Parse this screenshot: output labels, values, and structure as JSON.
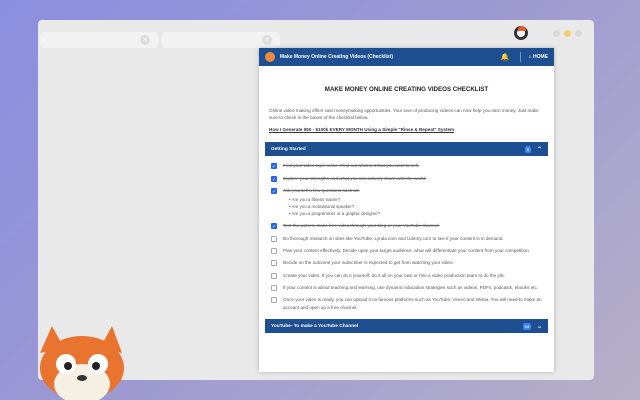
{
  "page": {
    "header": {
      "title": "Make Money Online Creating Videos (Checklist)",
      "home_label": "HOME",
      "bell_icon": "bell-icon",
      "home_icon": "home-icon"
    },
    "heading": "MAKE MONEY ONLINE CREATING VIDEOS CHECKLIST",
    "intro": "Online video making offers vast moneymaking opportunities. Your love of producing videos can now help you earn money. Just make sure to check in the boxes of the checklist below.",
    "link": "How I Generate $50 - $100k EVERY MONTH Using a Simple \"Rinse & Repeat\" System",
    "sections": [
      {
        "title": "Getting Started",
        "badge": "5"
      },
      {
        "title": "YouTube- To make a YouTube Channel",
        "badge": "14"
      }
    ],
    "items": [
      {
        "text": "Find your video topic niche. Find out what is it that you want to sell.",
        "checked": true
      },
      {
        "text": "Explore your strengths and what you can actively share with the world.",
        "checked": true
      },
      {
        "text": "Ask yourself a few questions such as:",
        "checked": true
      },
      {
        "text": "Test the waters, make free video through your blog or your YouTube channel.",
        "checked": true
      },
      {
        "text": "Do thorough research on sites like YouTube, Lynda.com and Udemy.com to see if your content is in demand.",
        "checked": false
      },
      {
        "text": "Plan your content effectively. Decide upon your target audience, what will differentiate your content from your competition.",
        "checked": false
      },
      {
        "text": "Decide on the outcome your subscriber is expected to get from watching your video.",
        "checked": false
      },
      {
        "text": "Create your video. If you can do it yourself, do it all on your own or hire a video production team to do the job.",
        "checked": false
      },
      {
        "text": "If your content is about teaching and learning, use dynamic education strategies such as videos, PDFs, podcasts, ebooks etc.",
        "checked": false
      },
      {
        "text": "Once your video is ready, you can upload it on famous platforms such as YouTube, Vimeo and Wistia. You will need to make an account and open up a free channel.",
        "checked": false
      }
    ],
    "subitems": [
      "Are you a fitness trainer?",
      "Are you a motivational speaker?",
      "Are you a programmer or a graphic designer?"
    ]
  },
  "colors": {
    "header": "#1d4f91",
    "checkbox": "#2563eb",
    "background": "#8a8fe0"
  }
}
